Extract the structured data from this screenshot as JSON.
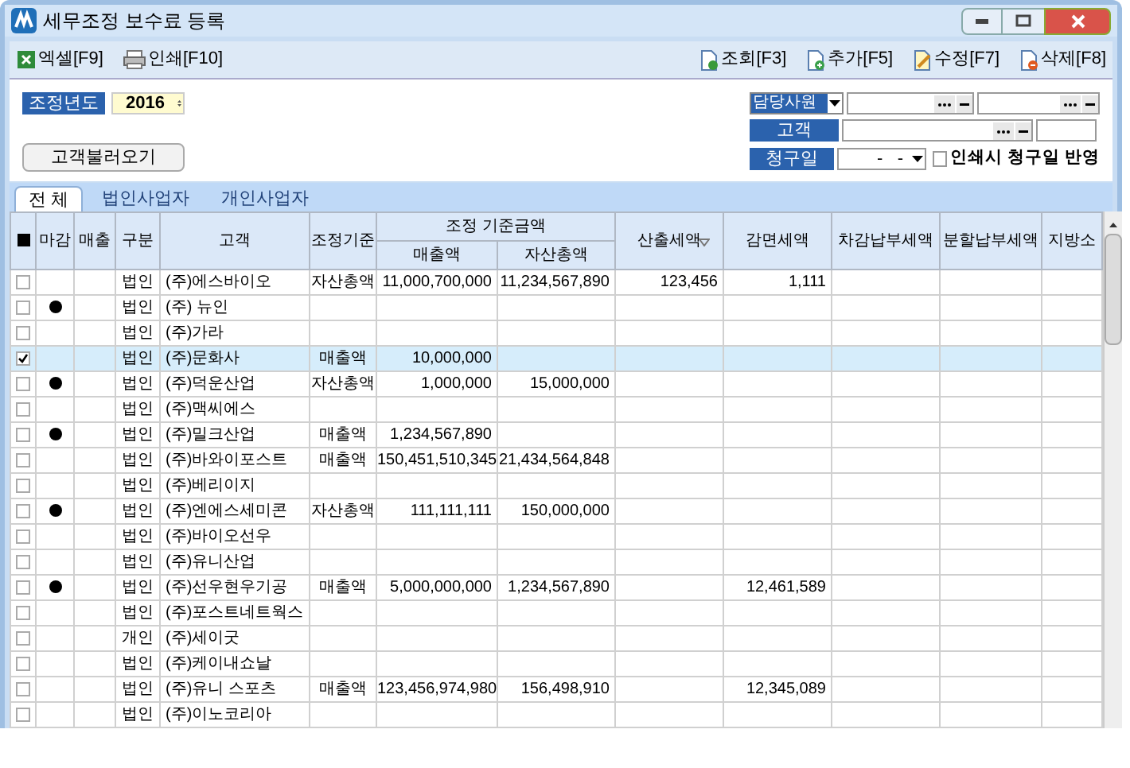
{
  "window": {
    "title": "세무조정 보수료 등록"
  },
  "toolbar": {
    "left": [
      {
        "label": "엑셀[F9]",
        "kind": "excel"
      },
      {
        "label": "인쇄[F10]",
        "kind": "print"
      }
    ],
    "right": [
      {
        "label": "조회[F3]",
        "kind": "query"
      },
      {
        "label": "추가[F5]",
        "kind": "add"
      },
      {
        "label": "수정[F7]",
        "kind": "edit"
      },
      {
        "label": "삭제[F8]",
        "kind": "delete"
      }
    ]
  },
  "filters": {
    "year_label": "조정년도",
    "year": "2016",
    "load_button": "고객불러오기",
    "staff_select": "담당사원",
    "customer_label": "고객",
    "billing_label": "청구일",
    "billing_date": "-   -",
    "print_option": {
      "label": "인쇄시 청구일 반영",
      "checked": false
    }
  },
  "tabs": [
    {
      "label": "전 체",
      "selected": true
    },
    {
      "label": "법인사업자",
      "selected": false
    },
    {
      "label": "개인사업자",
      "selected": false
    }
  ],
  "table": {
    "all_checked": true,
    "columns": [
      {
        "label": "마감",
        "sorted": false
      },
      {
        "label": "매출",
        "sorted": false
      },
      {
        "label": "구분",
        "sorted": false
      },
      {
        "label": "고객",
        "sorted": false
      },
      {
        "label": "조정기준",
        "sorted": false
      },
      {
        "label": "조정 기준금액",
        "children": [
          {
            "label": "매출액"
          },
          {
            "label": "자산총액"
          }
        ]
      },
      {
        "label": "산출세액",
        "sorted": true
      },
      {
        "label": "감면세액",
        "sorted": false
      },
      {
        "label": "차감납부세액",
        "sorted": false
      },
      {
        "label": "분할납부세액",
        "sorted": false
      },
      {
        "label": "지방소",
        "sorted": false
      }
    ],
    "rows": [
      {
        "checked": false,
        "closed": false,
        "selected": false,
        "type": "법인",
        "customer": "(주)에스바이오",
        "basis": "자산총액",
        "sales": "11,000,700,000",
        "assets": "11,234,567,890",
        "tax": "123,456",
        "reduction": "1,111"
      },
      {
        "checked": false,
        "closed": true,
        "selected": false,
        "type": "법인",
        "customer": "(주) 뉴인"
      },
      {
        "checked": false,
        "closed": false,
        "selected": false,
        "type": "법인",
        "customer": "(주)가라"
      },
      {
        "checked": true,
        "closed": false,
        "selected": true,
        "type": "법인",
        "customer": "(주)문화사",
        "basis": "매출액",
        "sales": "10,000,000"
      },
      {
        "checked": false,
        "closed": true,
        "selected": false,
        "type": "법인",
        "customer": "(주)덕운산업",
        "basis": "자산총액",
        "sales": "1,000,000",
        "assets": "15,000,000"
      },
      {
        "checked": false,
        "closed": false,
        "selected": false,
        "type": "법인",
        "customer": "(주)맥씨에스"
      },
      {
        "checked": false,
        "closed": true,
        "selected": false,
        "type": "법인",
        "customer": "(주)밀크산업",
        "basis": "매출액",
        "sales": "1,234,567,890"
      },
      {
        "checked": false,
        "closed": false,
        "selected": false,
        "type": "법인",
        "customer": "(주)바와이포스트",
        "basis": "매출액",
        "sales": "150,451,510,345",
        "assets": "21,434,564,848"
      },
      {
        "checked": false,
        "closed": false,
        "selected": false,
        "type": "법인",
        "customer": "(주)베리이지"
      },
      {
        "checked": false,
        "closed": true,
        "selected": false,
        "type": "법인",
        "customer": "(주)엔에스세미콘",
        "basis": "자산총액",
        "sales": "111,111,111",
        "assets": "150,000,000"
      },
      {
        "checked": false,
        "closed": false,
        "selected": false,
        "type": "법인",
        "customer": "(주)바이오선우"
      },
      {
        "checked": false,
        "closed": false,
        "selected": false,
        "type": "법인",
        "customer": "(주)유니산업"
      },
      {
        "checked": false,
        "closed": true,
        "selected": false,
        "type": "법인",
        "customer": "(주)선우현우기공",
        "basis": "매출액",
        "sales": "5,000,000,000",
        "assets": "1,234,567,890",
        "reduction": "12,461,589"
      },
      {
        "checked": false,
        "closed": false,
        "selected": false,
        "type": "법인",
        "customer": "(주)포스트네트웍스"
      },
      {
        "checked": false,
        "closed": false,
        "selected": false,
        "type": "개인",
        "customer": "(주)세이굿"
      },
      {
        "checked": false,
        "closed": false,
        "selected": false,
        "type": "법인",
        "customer": "(주)케이내쇼날"
      },
      {
        "checked": false,
        "closed": false,
        "selected": false,
        "type": "법인",
        "customer": "(주)유니 스포츠",
        "basis": "매출액",
        "sales": "123,456,974,980",
        "assets": "156,498,910",
        "reduction": "12,345,089"
      },
      {
        "checked": false,
        "closed": false,
        "selected": false,
        "type": "법인",
        "customer": "(주)이노코리아"
      }
    ]
  }
}
